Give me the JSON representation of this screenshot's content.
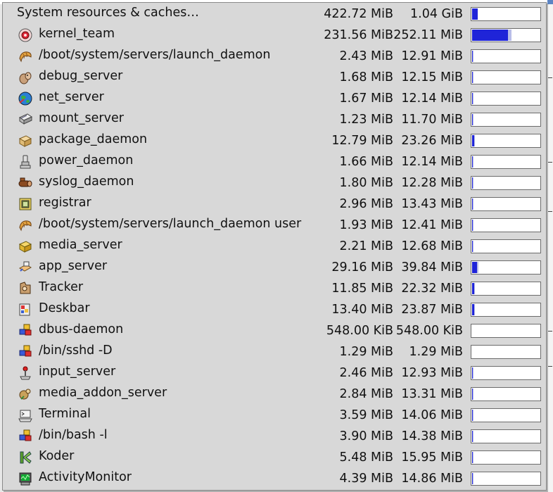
{
  "menu": {
    "header": {
      "label": "System resources & caches…",
      "memory": "422.72 MiB",
      "virtual": "1.04 GiB",
      "usage": 0.08,
      "usage_secondary": 0.0
    },
    "processes": [
      {
        "name": "kernel_team",
        "memory": "231.56 MiB",
        "virtual": "252.11 MiB",
        "usage": 0.53,
        "usage_secondary": 0.05,
        "icon": "kernel-icon"
      },
      {
        "name": "/boot/system/servers/launch_daemon",
        "memory": "2.43 MiB",
        "virtual": "12.91 MiB",
        "usage": 0.01,
        "usage_secondary": 0.01,
        "icon": "croissant-icon"
      },
      {
        "name": "debug_server",
        "memory": "1.68 MiB",
        "virtual": "12.15 MiB",
        "usage": 0.01,
        "usage_secondary": 0.01,
        "icon": "bug-icon"
      },
      {
        "name": "net_server",
        "memory": "1.67 MiB",
        "virtual": "12.14 MiB",
        "usage": 0.01,
        "usage_secondary": 0.01,
        "icon": "globe-icon"
      },
      {
        "name": "mount_server",
        "memory": "1.23 MiB",
        "virtual": "11.70 MiB",
        "usage": 0.01,
        "usage_secondary": 0.01,
        "icon": "drive-icon"
      },
      {
        "name": "package_daemon",
        "memory": "12.79 MiB",
        "virtual": "23.26 MiB",
        "usage": 0.03,
        "usage_secondary": 0.01,
        "icon": "package-icon"
      },
      {
        "name": "power_daemon",
        "memory": "1.66 MiB",
        "virtual": "12.14 MiB",
        "usage": 0.01,
        "usage_secondary": 0.01,
        "icon": "plug-icon"
      },
      {
        "name": "syslog_daemon",
        "memory": "1.80 MiB",
        "virtual": "12.28 MiB",
        "usage": 0.01,
        "usage_secondary": 0.01,
        "icon": "log-icon"
      },
      {
        "name": "registrar",
        "memory": "2.96 MiB",
        "virtual": "13.43 MiB",
        "usage": 0.01,
        "usage_secondary": 0.01,
        "icon": "registry-icon"
      },
      {
        "name": "/boot/system/servers/launch_daemon user",
        "memory": "1.93 MiB",
        "virtual": "12.41 MiB",
        "usage": 0.01,
        "usage_secondary": 0.01,
        "icon": "croissant-icon"
      },
      {
        "name": "media_server",
        "memory": "2.21 MiB",
        "virtual": "12.68 MiB",
        "usage": 0.01,
        "usage_secondary": 0.01,
        "icon": "media-box-icon"
      },
      {
        "name": "app_server",
        "memory": "29.16 MiB",
        "virtual": "39.84 MiB",
        "usage": 0.07,
        "usage_secondary": 0.02,
        "icon": "app-server-icon"
      },
      {
        "name": "Tracker",
        "memory": "11.85 MiB",
        "virtual": "22.32 MiB",
        "usage": 0.03,
        "usage_secondary": 0.01,
        "icon": "tracker-icon"
      },
      {
        "name": "Deskbar",
        "memory": "13.40 MiB",
        "virtual": "23.87 MiB",
        "usage": 0.03,
        "usage_secondary": 0.01,
        "icon": "deskbar-icon"
      },
      {
        "name": "dbus-daemon",
        "memory": "548.00 KiB",
        "virtual": "548.00 KiB",
        "usage": 0.0,
        "usage_secondary": 0.0,
        "icon": "cubes-icon"
      },
      {
        "name": "/bin/sshd -D",
        "memory": "1.29 MiB",
        "virtual": "1.29 MiB",
        "usage": 0.0,
        "usage_secondary": 0.0,
        "icon": "cubes-icon"
      },
      {
        "name": "input_server",
        "memory": "2.46 MiB",
        "virtual": "12.93 MiB",
        "usage": 0.01,
        "usage_secondary": 0.01,
        "icon": "joystick-icon"
      },
      {
        "name": "media_addon_server",
        "memory": "2.84 MiB",
        "virtual": "13.31 MiB",
        "usage": 0.01,
        "usage_secondary": 0.01,
        "icon": "addon-icon"
      },
      {
        "name": "Terminal",
        "memory": "3.59 MiB",
        "virtual": "14.06 MiB",
        "usage": 0.01,
        "usage_secondary": 0.01,
        "icon": "terminal-icon"
      },
      {
        "name": "/bin/bash -l",
        "memory": "3.90 MiB",
        "virtual": "14.38 MiB",
        "usage": 0.01,
        "usage_secondary": 0.01,
        "icon": "cubes-icon"
      },
      {
        "name": "Koder",
        "memory": "5.48 MiB",
        "virtual": "15.95 MiB",
        "usage": 0.01,
        "usage_secondary": 0.01,
        "icon": "koder-icon"
      },
      {
        "name": "ActivityMonitor",
        "memory": "4.39 MiB",
        "virtual": "14.86 MiB",
        "usage": 0.01,
        "usage_secondary": 0.01,
        "icon": "activity-monitor-icon"
      }
    ]
  },
  "colors": {
    "bar_fill": "#1f24d8",
    "bar_fill_secondary": "#b9bde8",
    "menu_bg": "#d8d8d8"
  }
}
